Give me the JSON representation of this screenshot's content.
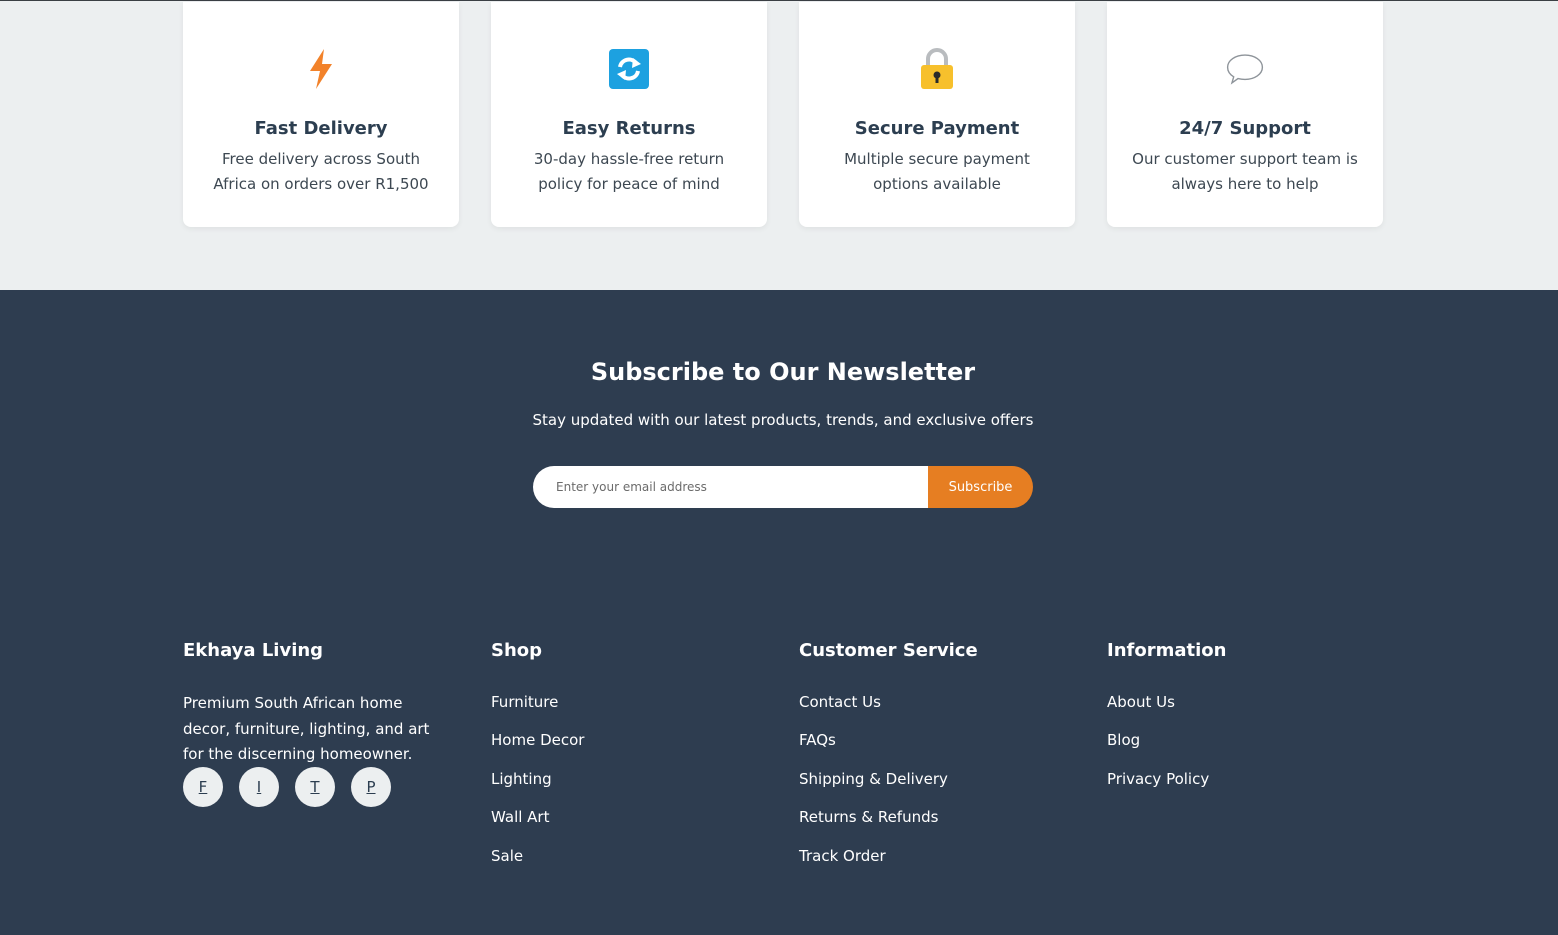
{
  "features": [
    {
      "icon": "lightning-icon",
      "title": "Fast Delivery",
      "desc": "Free delivery across South Africa on orders over R1,500"
    },
    {
      "icon": "refresh-icon",
      "title": "Easy Returns",
      "desc": "30-day hassle-free return policy for peace of mind"
    },
    {
      "icon": "lock-icon",
      "title": "Secure Payment",
      "desc": "Multiple secure payment options available"
    },
    {
      "icon": "speech-bubble-icon",
      "title": "24/7 Support",
      "desc": "Our customer support team is always here to help"
    }
  ],
  "newsletter": {
    "title": "Subscribe to Our Newsletter",
    "subtitle": "Stay updated with our latest products, trends, and exclusive offers",
    "placeholder": "Enter your email address",
    "button": "Subscribe"
  },
  "footer": {
    "brand": {
      "title": "Ekhaya Living",
      "about": "Premium South African home decor, furniture, lighting, and art for the discerning homeowner.",
      "socials": [
        "F",
        "I",
        "T",
        "P"
      ]
    },
    "shop": {
      "title": "Shop",
      "links": [
        "Furniture",
        "Home Decor",
        "Lighting",
        "Wall Art",
        "Sale"
      ]
    },
    "service": {
      "title": "Customer Service",
      "links": [
        "Contact Us",
        "FAQs",
        "Shipping & Delivery",
        "Returns & Refunds",
        "Track Order"
      ]
    },
    "info": {
      "title": "Information",
      "links": [
        "About Us",
        "Blog",
        "Privacy Policy"
      ]
    }
  },
  "colors": {
    "accent": "#e67e22",
    "footer_bg": "#2e3d50",
    "features_bg": "#eceff0",
    "heading": "#2c3e50"
  }
}
